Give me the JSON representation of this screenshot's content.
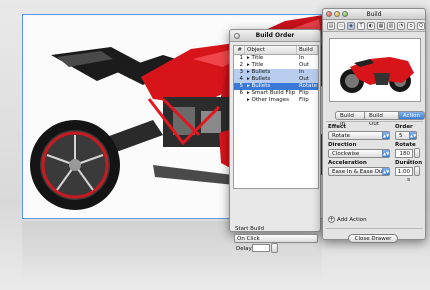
{
  "build_order": {
    "title": "Build Order",
    "columns": {
      "num": "#",
      "object": "Object",
      "build": "Build"
    },
    "rows": [
      {
        "num": "1",
        "object": "▸ Title",
        "build": "In",
        "state": ""
      },
      {
        "num": "2",
        "object": "▸ Title",
        "build": "Out",
        "state": ""
      },
      {
        "num": "3",
        "object": "▸ Bullets",
        "build": "In",
        "state": "sel2"
      },
      {
        "num": "4",
        "object": "▸ Bullets",
        "build": "Out",
        "state": "sel2"
      },
      {
        "num": "5",
        "object": "▸ Bullets",
        "build": "Rotate",
        "state": "sel"
      },
      {
        "num": "6",
        "object": "▸ Smart Build Flip",
        "build": "Flip",
        "state": ""
      },
      {
        "num": "",
        "object": "▸ Other Images",
        "build": "Flip",
        "state": ""
      }
    ],
    "start_build_label": "Start Build",
    "start_build_value": "On Click",
    "delay_label": "Delay",
    "delay_value": ""
  },
  "inspector": {
    "title": "Build",
    "tabs": [
      {
        "label": "Build In",
        "active": false
      },
      {
        "label": "Build Out",
        "active": false
      },
      {
        "label": "Action",
        "active": true
      }
    ],
    "effect_label": "Effect",
    "effect_value": "Rotate",
    "order_label": "Order",
    "order_value": "5",
    "direction_label": "Direction",
    "direction_value": "Clockwise",
    "rotate_label": "Rotate",
    "rotate_value": "180 °",
    "acceleration_label": "Acceleration",
    "acceleration_value": "Ease In & Ease Out",
    "duration_label": "Duration",
    "duration_value": "1.00 s",
    "add_action_label": "Add Action",
    "close_drawer_label": "Close Drawer"
  },
  "colors": {
    "bike_red": "#d8141b",
    "selection_blue": "#3b78d8",
    "canvas_bg": "#e2e2e2"
  }
}
